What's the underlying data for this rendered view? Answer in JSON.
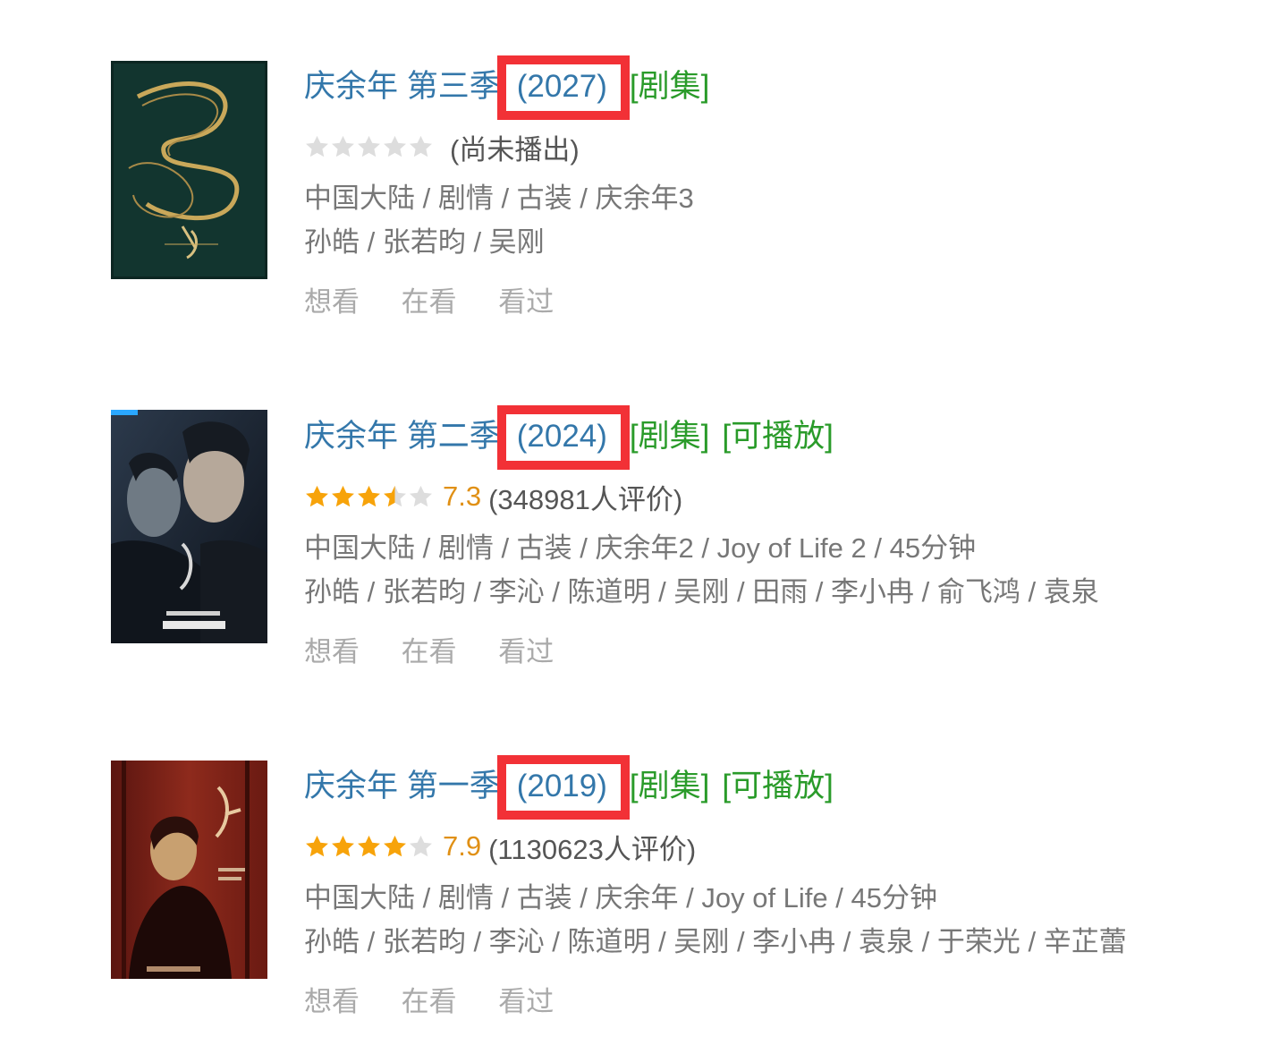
{
  "items": [
    {
      "title": "庆余年 第三季",
      "year": "(2027)",
      "type_tag": "[剧集]",
      "play_tag": "",
      "rating_score": "",
      "rating_text": "(尚未播出)",
      "stars": 0,
      "meta_line": "中国大陆 / 剧情 / 古装 / 庆余年3",
      "cast_line": "孙皓 / 张若昀 / 吴刚",
      "poster_colors": [
        "#12352f",
        "#c9a85a"
      ],
      "actions": [
        "想看",
        "在看",
        "看过"
      ]
    },
    {
      "title": "庆余年 第二季",
      "year": "(2024)",
      "type_tag": "[剧集]",
      "play_tag": "[可播放]",
      "rating_score": "7.3",
      "rating_text": "(348981人评价)",
      "stars": 3.5,
      "meta_line": "中国大陆 / 剧情 / 古装 / 庆余年2 / Joy of Life 2 / 45分钟",
      "cast_line": "孙皓 / 张若昀 / 李沁 / 陈道明 / 吴刚 / 田雨 / 李小冉 / 俞飞鸿 / 袁泉",
      "poster_colors": [
        "#1a2230",
        "#9fb0c0"
      ],
      "actions": [
        "想看",
        "在看",
        "看过"
      ]
    },
    {
      "title": "庆余年 第一季",
      "year": "(2019)",
      "type_tag": "[剧集]",
      "play_tag": "[可播放]",
      "rating_score": "7.9",
      "rating_text": "(1130623人评价)",
      "stars": 4,
      "meta_line": "中国大陆 / 剧情 / 古装 / 庆余年 / Joy of Life / 45分钟",
      "cast_line": "孙皓 / 张若昀 / 李沁 / 陈道明 / 吴刚 / 李小冉 / 袁泉 / 于荣光 / 辛芷蕾",
      "poster_colors": [
        "#7a1f18",
        "#c8a070"
      ],
      "actions": [
        "想看",
        "在看",
        "看过"
      ]
    }
  ],
  "colors": {
    "title": "#3377aa",
    "highlight_box": "#f23136",
    "tag": "#2a9b2a",
    "score": "#e09015",
    "star_filled": "#f7a30a",
    "star_empty": "#dddddd"
  }
}
